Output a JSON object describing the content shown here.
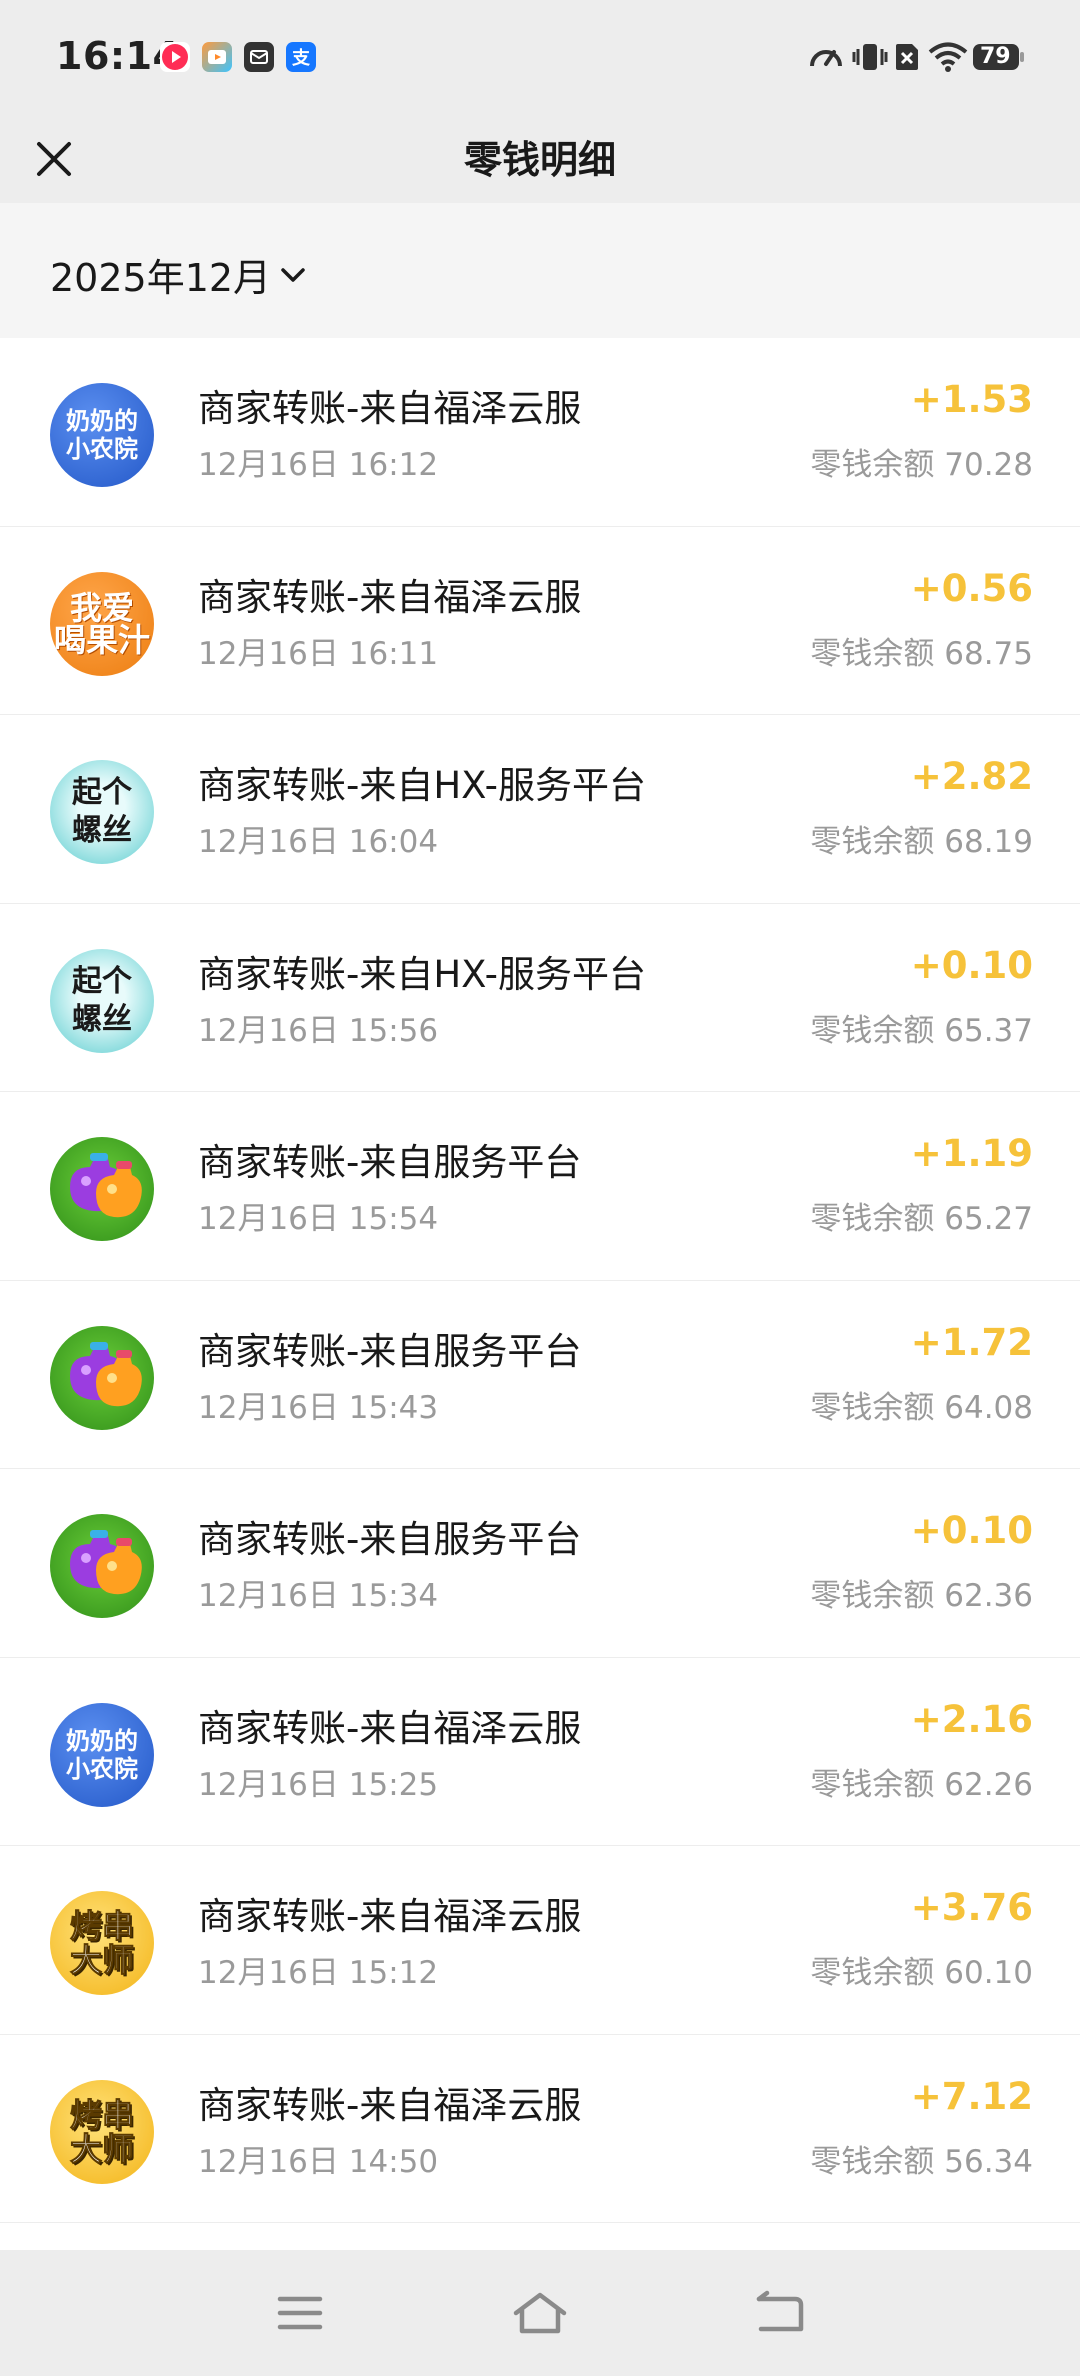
{
  "status_bar": {
    "time": "16:14",
    "battery": "79",
    "notif_alipay": "支"
  },
  "header": {
    "title": "零钱明细"
  },
  "month_selector": {
    "label": "2025年12月"
  },
  "transactions": [
    {
      "title": "商家转账-来自福泽云服",
      "time": "12月16日 16:12",
      "amount": "+1.53",
      "balance": "零钱余额 70.28",
      "avatar_text": "奶奶的\n小农院",
      "avatar_style": "blue"
    },
    {
      "title": "商家转账-来自福泽云服",
      "time": "12月16日 16:11",
      "amount": "+0.56",
      "balance": "零钱余额 68.75",
      "avatar_text": "我爱\n喝果汁",
      "avatar_style": "orange"
    },
    {
      "title": "商家转账-来自HX-服务平台",
      "time": "12月16日 16:04",
      "amount": "+2.82",
      "balance": "零钱余额 68.19",
      "avatar_text": "起个\n螺丝",
      "avatar_style": "cyan"
    },
    {
      "title": "商家转账-来自HX-服务平台",
      "time": "12月16日 15:56",
      "amount": "+0.10",
      "balance": "零钱余额 65.37",
      "avatar_text": "起个\n螺丝",
      "avatar_style": "cyan"
    },
    {
      "title": "商家转账-来自服务平台",
      "time": "12月16日 15:54",
      "amount": "+1.19",
      "balance": "零钱余额 65.27",
      "avatar_text": "",
      "avatar_style": "green"
    },
    {
      "title": "商家转账-来自服务平台",
      "time": "12月16日 15:43",
      "amount": "+1.72",
      "balance": "零钱余额 64.08",
      "avatar_text": "",
      "avatar_style": "green"
    },
    {
      "title": "商家转账-来自服务平台",
      "time": "12月16日 15:34",
      "amount": "+0.10",
      "balance": "零钱余额 62.36",
      "avatar_text": "",
      "avatar_style": "green"
    },
    {
      "title": "商家转账-来自福泽云服",
      "time": "12月16日 15:25",
      "amount": "+2.16",
      "balance": "零钱余额 62.26",
      "avatar_text": "奶奶的\n小农院",
      "avatar_style": "blue"
    },
    {
      "title": "商家转账-来自福泽云服",
      "time": "12月16日 15:12",
      "amount": "+3.76",
      "balance": "零钱余额 60.10",
      "avatar_text": "烤串\n大师",
      "avatar_style": "yellow"
    },
    {
      "title": "商家转账-来自福泽云服",
      "time": "12月16日 14:50",
      "amount": "+7.12",
      "balance": "零钱余额 56.34",
      "avatar_text": "烤串\n大师",
      "avatar_style": "yellow"
    }
  ],
  "colors": {
    "amount": "#f6c23a",
    "header_bg": "#ededed",
    "month_bg": "#f5f5f5"
  },
  "icons": {
    "close": "close-icon",
    "chevron": "chevron-down-icon",
    "nav_menu": "menu-icon",
    "nav_home": "home-icon",
    "nav_back": "back-icon"
  }
}
